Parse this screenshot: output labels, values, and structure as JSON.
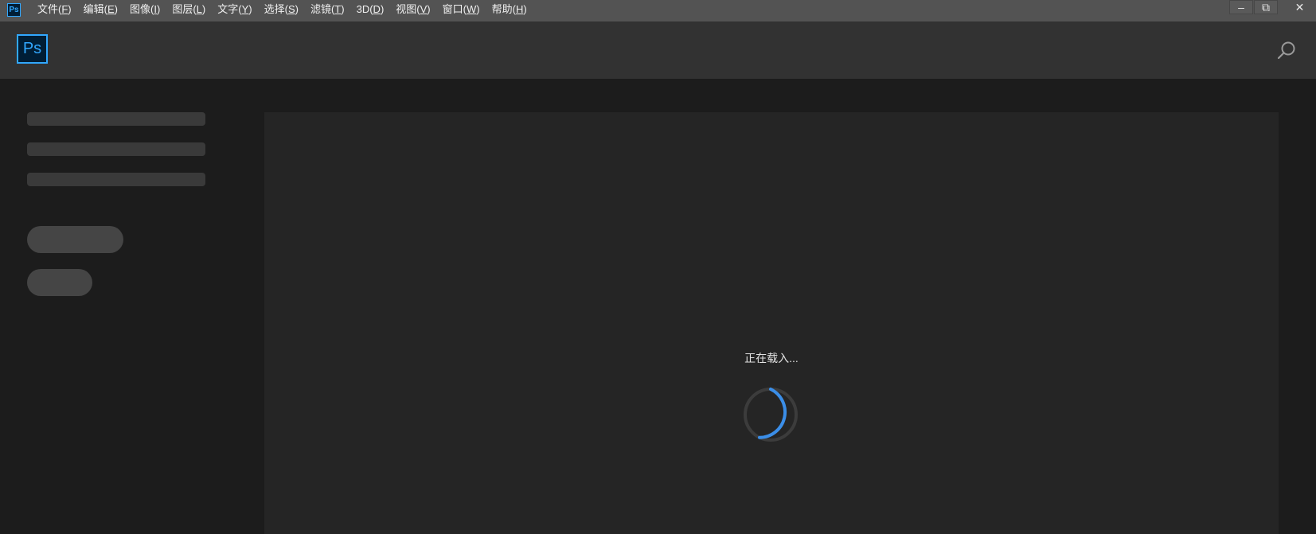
{
  "menubar": {
    "app_icon_text": "Ps",
    "items": [
      {
        "label": "文件(",
        "key": "F",
        "close": ")"
      },
      {
        "label": "编辑(",
        "key": "E",
        "close": ")"
      },
      {
        "label": "图像(",
        "key": "I",
        "close": ")"
      },
      {
        "label": "图层(",
        "key": "L",
        "close": ")"
      },
      {
        "label": "文字(",
        "key": "Y",
        "close": ")"
      },
      {
        "label": "选择(",
        "key": "S",
        "close": ")"
      },
      {
        "label": "滤镜(",
        "key": "T",
        "close": ")"
      },
      {
        "label": "3D(",
        "key": "D",
        "close": ")"
      },
      {
        "label": "视图(",
        "key": "V",
        "close": ")"
      },
      {
        "label": "窗口(",
        "key": "W",
        "close": ")"
      },
      {
        "label": "帮助(",
        "key": "H",
        "close": ")"
      }
    ],
    "window_controls": {
      "minimize": "–",
      "restore": "⧉",
      "close": "✕"
    }
  },
  "header": {
    "logo_text": "Ps",
    "search_icon": "search-icon"
  },
  "main": {
    "loading_text": "正在载入..."
  },
  "colors": {
    "accent": "#31a8ff",
    "spinner_track": "#3c3c3c",
    "spinner_arc": "#3b8ee8"
  }
}
